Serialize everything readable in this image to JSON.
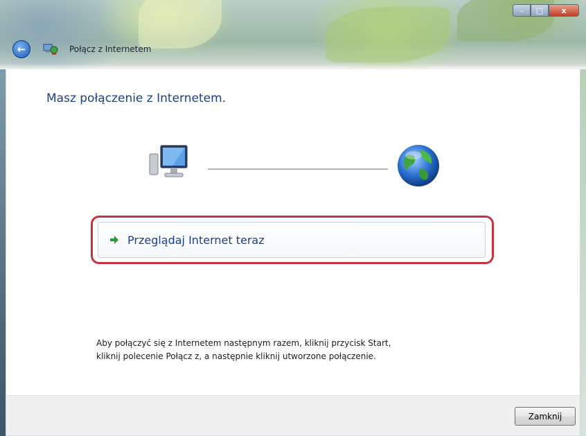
{
  "window": {
    "title": "Połącz z Internetem",
    "caption_buttons": {
      "minimize": "–",
      "maximize": "□",
      "close": "x"
    },
    "back_button_glyph": "←"
  },
  "main": {
    "heading": "Masz połączenie z Internetem.",
    "diagram": {
      "left_icon": "computer-icon",
      "right_icon": "globe-icon"
    },
    "browse_link": {
      "label": "Przeglądaj Internet teraz",
      "icon": "green-arrow-icon"
    },
    "info_text_line1": "Aby połączyć się z Internetem następnym razem, kliknij przycisk Start,",
    "info_text_line2": "kliknij polecenie Połącz z, a następnie kliknij utworzone połączenie."
  },
  "footer": {
    "close_label": "Zamknij"
  },
  "colors": {
    "heading": "#1e3f8c",
    "highlight": "#c8323c",
    "link": "#1e3f8c"
  }
}
